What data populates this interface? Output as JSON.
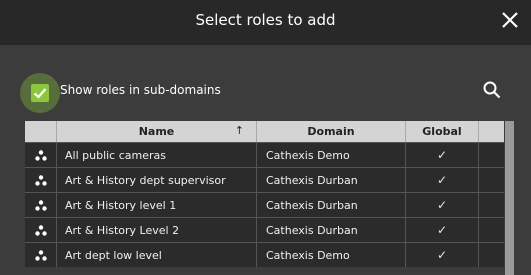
{
  "dialog": {
    "title": "Select roles to add"
  },
  "filter": {
    "show_subdomains_label": "Show roles in sub-domains",
    "checked": true
  },
  "table": {
    "headers": {
      "name": "Name",
      "domain": "Domain",
      "global": "Global",
      "sort_indicator": "↑"
    },
    "rows": [
      {
        "name": "All public cameras",
        "domain": "Cathexis Demo",
        "global": "✓"
      },
      {
        "name": "Art & History dept supervisor",
        "domain": "Cathexis Durban",
        "global": "✓"
      },
      {
        "name": "Art & History level 1",
        "domain": "Cathexis Durban",
        "global": "✓"
      },
      {
        "name": "Art & History Level 2",
        "domain": "Cathexis Durban",
        "global": "✓"
      },
      {
        "name": "Art dept  low level",
        "domain": "Cathexis Demo",
        "global": "✓"
      }
    ]
  },
  "icons": {
    "close": "close-icon",
    "search": "search-icon",
    "role": "role-group-icon",
    "checkbox": "checkmark-icon"
  },
  "colors": {
    "accent": "#8fc63f"
  }
}
